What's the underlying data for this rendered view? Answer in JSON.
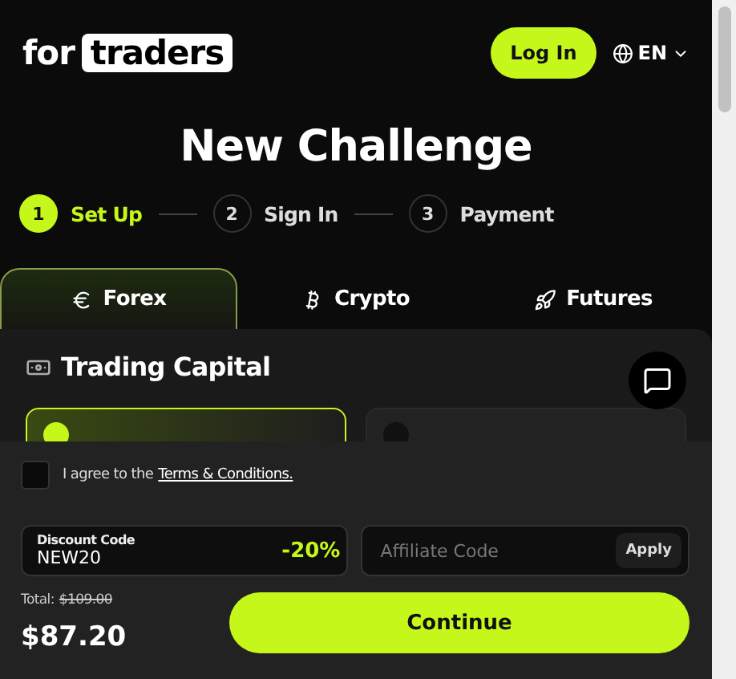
{
  "header": {
    "logo": {
      "prefix": "for",
      "boxed": "traders"
    },
    "login_button": "Log In",
    "language": "EN"
  },
  "title": "New Challenge",
  "steps": [
    {
      "number": "1",
      "label": "Set Up",
      "selected": true
    },
    {
      "number": "2",
      "label": "Sign In",
      "selected": false
    },
    {
      "number": "3",
      "label": "Payment",
      "selected": false
    }
  ],
  "tabs": [
    {
      "label": "Forex",
      "kind": "euro",
      "selected": true
    },
    {
      "label": "Crypto",
      "kind": "bitcoin",
      "selected": false
    },
    {
      "label": "Futures",
      "kind": "rocket",
      "selected": false
    }
  ],
  "panel": {
    "heading": "Trading Capital",
    "capital_options": [
      {
        "selected": true
      },
      {
        "selected": false
      }
    ]
  },
  "footer": {
    "agree": {
      "checked": false,
      "text": "I agree to the",
      "link": "Terms & Conditions."
    },
    "discount": {
      "label": "Discount Code",
      "value": "NEW20",
      "badge": "-20%"
    },
    "affiliate": {
      "placeholder": "Affiliate Code",
      "button": "Apply"
    },
    "total_label": "Total:",
    "original_price": "$109.00",
    "price": "$87.20",
    "continue_button": "Continue"
  }
}
